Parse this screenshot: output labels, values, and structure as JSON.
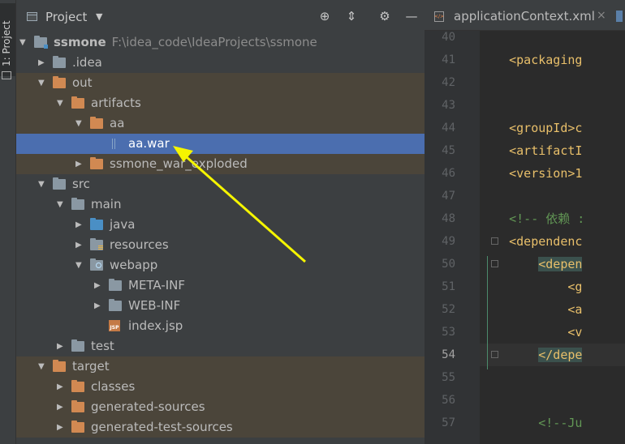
{
  "stripe": {
    "label": "1: Project"
  },
  "panel": {
    "title": "Project",
    "dropdown_glyph": "▼",
    "icons": [
      "target-icon",
      "collapse-icon",
      "gear-icon",
      "minimize-icon"
    ]
  },
  "tree": [
    {
      "label": "ssmone",
      "path": "F:\\idea_code\\IdeaProjects\\ssmone",
      "depth": 0,
      "expanded": true,
      "icon": "module-folder-icon",
      "state": ""
    },
    {
      "label": ".idea",
      "depth": 1,
      "expanded": false,
      "icon": "folder-icon",
      "state": ""
    },
    {
      "label": "out",
      "depth": 1,
      "expanded": true,
      "icon": "excluded-folder-icon",
      "state": "excluded"
    },
    {
      "label": "artifacts",
      "depth": 2,
      "expanded": true,
      "icon": "excluded-folder-icon",
      "state": "excluded"
    },
    {
      "label": "aa",
      "depth": 3,
      "expanded": true,
      "icon": "excluded-folder-icon",
      "state": "excluded"
    },
    {
      "label": "aa.war",
      "depth": 4,
      "expanded": null,
      "icon": "war-file-icon",
      "state": "selected"
    },
    {
      "label": "ssmone_war_exploded",
      "depth": 3,
      "expanded": false,
      "icon": "excluded-folder-icon",
      "state": "excluded"
    },
    {
      "label": "src",
      "depth": 1,
      "expanded": true,
      "icon": "folder-icon",
      "state": ""
    },
    {
      "label": "main",
      "depth": 2,
      "expanded": true,
      "icon": "folder-icon",
      "state": ""
    },
    {
      "label": "java",
      "depth": 3,
      "expanded": false,
      "icon": "source-folder-icon",
      "state": ""
    },
    {
      "label": "resources",
      "depth": 3,
      "expanded": false,
      "icon": "resources-folder-icon",
      "state": ""
    },
    {
      "label": "webapp",
      "depth": 3,
      "expanded": true,
      "icon": "web-folder-icon",
      "state": ""
    },
    {
      "label": "META-INF",
      "depth": 4,
      "expanded": false,
      "icon": "folder-icon",
      "state": ""
    },
    {
      "label": "WEB-INF",
      "depth": 4,
      "expanded": false,
      "icon": "folder-icon",
      "state": ""
    },
    {
      "label": "index.jsp",
      "depth": 4,
      "expanded": null,
      "icon": "jsp-file-icon",
      "state": ""
    },
    {
      "label": "test",
      "depth": 2,
      "expanded": false,
      "icon": "folder-icon",
      "state": ""
    },
    {
      "label": "target",
      "depth": 1,
      "expanded": true,
      "icon": "excluded-folder-icon",
      "state": "excluded"
    },
    {
      "label": "classes",
      "depth": 2,
      "expanded": false,
      "icon": "excluded-folder-icon",
      "state": "excluded"
    },
    {
      "label": "generated-sources",
      "depth": 2,
      "expanded": false,
      "icon": "excluded-folder-icon",
      "state": "excluded"
    },
    {
      "label": "generated-test-sources",
      "depth": 2,
      "expanded": false,
      "icon": "excluded-folder-icon",
      "state": "excluded"
    }
  ],
  "editor": {
    "tab_label": "applicationContext.xml",
    "tab_close": "×",
    "current_line": 54,
    "lines": [
      {
        "n": "40",
        "text": ""
      },
      {
        "n": "41",
        "text": "    <packaging"
      },
      {
        "n": "42",
        "text": ""
      },
      {
        "n": "43",
        "text": ""
      },
      {
        "n": "44",
        "text": "    <groupId>c"
      },
      {
        "n": "45",
        "text": "    <artifactI"
      },
      {
        "n": "46",
        "text": "    <version>1"
      },
      {
        "n": "47",
        "text": ""
      },
      {
        "n": "48",
        "text": "    <!-- 依赖 :"
      },
      {
        "n": "49",
        "text": "    <dependenc"
      },
      {
        "n": "50",
        "text": "        <depen"
      },
      {
        "n": "51",
        "text": "            <g"
      },
      {
        "n": "52",
        "text": "            <a"
      },
      {
        "n": "53",
        "text": "            <v"
      },
      {
        "n": "54",
        "text": "        </depe"
      },
      {
        "n": "55",
        "text": ""
      },
      {
        "n": "56",
        "text": ""
      },
      {
        "n": "57",
        "text": "        <!--Ju"
      }
    ]
  },
  "colors": {
    "selection": "#4b6eaf",
    "excluded_bg": "#4b453a",
    "annotation_arrow": "#f5f500"
  }
}
